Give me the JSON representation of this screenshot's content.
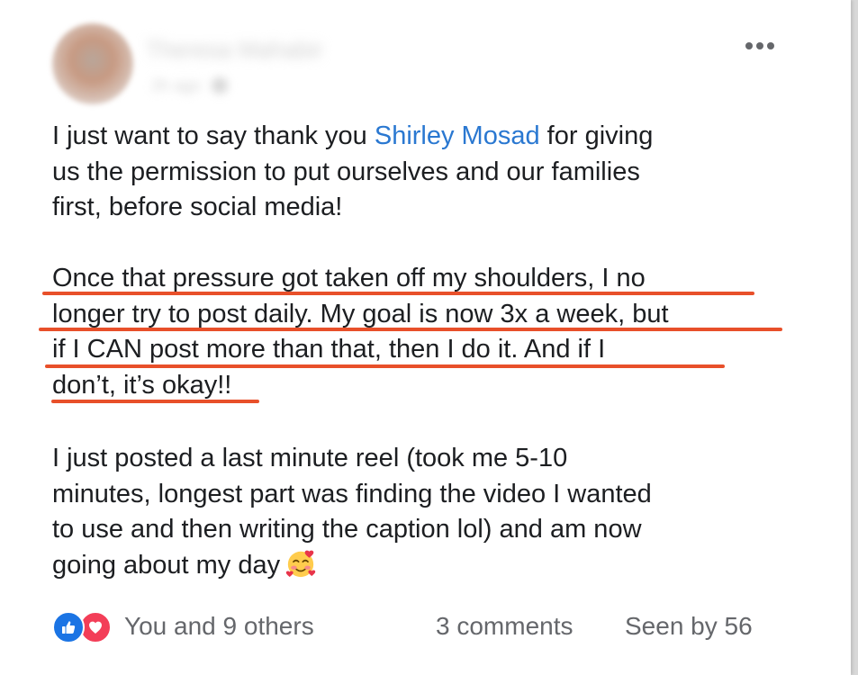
{
  "post": {
    "author": {
      "name": "Theresa Mahabir",
      "time": "2h ago"
    },
    "menu_icon": "more-horizontal-icon",
    "paragraph1": {
      "line1_before": "I just want to say thank you ",
      "mention": "Shirley Mosad",
      "line1_after": " for giving",
      "line2": "us the permission to put ourselves and our families",
      "line3": "first, before social media!"
    },
    "paragraph2": {
      "lines": [
        "Once that pressure got taken off my shoulders, I no",
        "longer try to post daily. My goal is now 3x a week, but",
        "if I CAN post more than that, then I do it. And if I",
        "don’t, it’s okay!!"
      ],
      "highlight_color": "#e8502a"
    },
    "paragraph3": {
      "lines": [
        "I just posted a last minute reel (took me 5-10",
        "minutes, longest part was finding the video I wanted",
        "to use and then writing the caption lol) and am now",
        "going about my day"
      ],
      "emoji": "smiling-face-with-hearts"
    },
    "footer": {
      "reaction_icons": [
        "like-icon",
        "love-icon"
      ],
      "reactions_text": "You and 9 others",
      "comments_text": "3 comments",
      "seen_text": "Seen by 56"
    },
    "colors": {
      "mention": "#2a78d1",
      "like": "#1b74e4",
      "love": "#f33e58",
      "secondary_text": "#65676b"
    }
  }
}
